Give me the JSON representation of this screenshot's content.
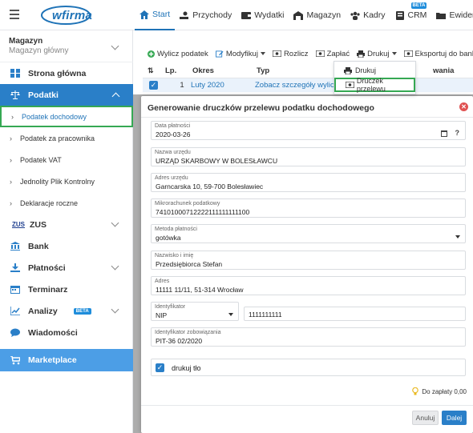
{
  "topnav": {
    "items": [
      {
        "label": "Start",
        "active": true
      },
      {
        "label": "Przychody"
      },
      {
        "label": "Wydatki"
      },
      {
        "label": "Magazyn"
      },
      {
        "label": "Kadry"
      },
      {
        "label": "CRM",
        "badge": "BETA"
      },
      {
        "label": "Ewidencje"
      }
    ],
    "logo": "wfirma"
  },
  "sidebar": {
    "warehouse_title": "Magazyn",
    "warehouse_sub": "Magazyn główny",
    "items": [
      {
        "label": "Strona główna"
      },
      {
        "label": "Podatki"
      },
      {
        "label": "Podatek dochodowy"
      },
      {
        "label": "Podatek za pracownika"
      },
      {
        "label": "Podatek VAT"
      },
      {
        "label": "Jednolity Plik Kontrolny"
      },
      {
        "label": "Deklaracje roczne"
      },
      {
        "label": "ZUS",
        "prefix": "ZUS"
      },
      {
        "label": "Bank"
      },
      {
        "label": "Płatności"
      },
      {
        "label": "Terminarz"
      },
      {
        "label": "Analizy",
        "badge": "BETA"
      },
      {
        "label": "Wiadomości"
      },
      {
        "label": "Marketplace"
      }
    ]
  },
  "toolbar": {
    "wylicz": "Wylicz podatek",
    "modyfikuj": "Modyfikuj",
    "rozlicz": "Rozlicz",
    "zaplac": "Zapłać",
    "drukuj": "Drukuj",
    "eksportuj": "Eksportuj do banku"
  },
  "dropdown": {
    "drukuj": "Drukuj",
    "druczek": "Druczek przelewu"
  },
  "table": {
    "headers": {
      "lp": "Lp.",
      "okres": "Okres",
      "typ": "Typ",
      "trailing": "wania"
    },
    "row": {
      "lp": "1",
      "okres": "Luty 2020",
      "typ": "Zobacz szczegóły wyliczenia"
    }
  },
  "modal": {
    "title": "Generowanie druczków przelewu podatku dochodowego",
    "fields": {
      "data_platnosci": {
        "label": "Data płatności",
        "value": "2020-03-26"
      },
      "nazwa_urzedu": {
        "label": "Nazwa urzędu",
        "value": "URZĄD SKARBOWY W BOLESŁAWCU"
      },
      "adres_urzedu": {
        "label": "Adres urzędu",
        "value": "Garncarska 10, 59-700 Bolesławiec"
      },
      "mikrorachunek": {
        "label": "Mikrorachunek podatkowy",
        "value": "74101000712222111111111100"
      },
      "metoda": {
        "label": "Metoda płatności",
        "value": "gotówka"
      },
      "nazwisko": {
        "label": "Nazwisko i imię",
        "value": "Przedsiębiorca Stefan"
      },
      "adres": {
        "label": "Adres",
        "value": "11111 11/11, 51-314 Wrocław"
      },
      "identyfikator": {
        "label": "Identyfikator",
        "type": "NIP",
        "value": "1111111111"
      },
      "identyfikator_zob": {
        "label": "Identyfikator zobowiązania",
        "value": "PIT-36 02/2020"
      }
    },
    "drukuj_tlo": "drukuj tło",
    "do_zaplaty": "Do zapłaty 0,00",
    "cancel": "Anuluj",
    "next": "Dalej",
    "qmark": "?"
  }
}
